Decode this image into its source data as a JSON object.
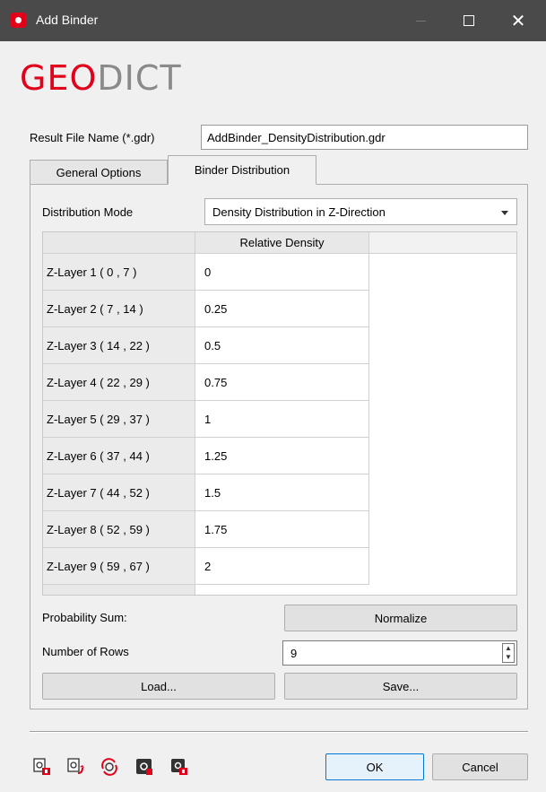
{
  "window": {
    "title": "Add Binder",
    "minimize": "—",
    "maximize": "☐",
    "close": "✕"
  },
  "logo": {
    "part1": "GEO",
    "part2": "DICT"
  },
  "result_file": {
    "label": "Result File Name (*.gdr)",
    "value": "AddBinder_DensityDistribution.gdr"
  },
  "tabs": [
    {
      "label": "General Options",
      "active": false
    },
    {
      "label": "Binder Distribution",
      "active": true
    }
  ],
  "distribution": {
    "label": "Distribution Mode",
    "value": "Density Distribution in Z-Direction"
  },
  "table": {
    "column_header": "Relative Density",
    "rows": [
      {
        "header": "Z-Layer 1 ( 0 , 7 )",
        "value": "0"
      },
      {
        "header": "Z-Layer 2 ( 7 , 14 )",
        "value": "0.25"
      },
      {
        "header": "Z-Layer 3 ( 14 , 22 )",
        "value": "0.5"
      },
      {
        "header": "Z-Layer 4 ( 22 , 29 )",
        "value": "0.75"
      },
      {
        "header": "Z-Layer 5 ( 29 , 37 )",
        "value": "1"
      },
      {
        "header": "Z-Layer 6 ( 37 , 44 )",
        "value": "1.25"
      },
      {
        "header": "Z-Layer 7 ( 44 , 52 )",
        "value": "1.5"
      },
      {
        "header": "Z-Layer 8 ( 52 , 59 )",
        "value": "1.75"
      },
      {
        "header": "Z-Layer 9 ( 59 , 67 )",
        "value": "2"
      }
    ]
  },
  "probability": {
    "label": "Probability Sum:",
    "normalize_label": "Normalize"
  },
  "rows_count": {
    "label": "Number of Rows",
    "value": "9"
  },
  "buttons": {
    "load": "Load...",
    "save": "Save...",
    "ok": "OK",
    "cancel": "Cancel"
  },
  "toolbar_icons": [
    "load-macro-icon",
    "save-macro-icon",
    "refresh-macro-icon",
    "settings-icon",
    "settings-lock-icon"
  ],
  "colors": {
    "brand_red": "#e2001a",
    "titlebar": "#4a4a4a",
    "ok_border": "#0078d7"
  }
}
